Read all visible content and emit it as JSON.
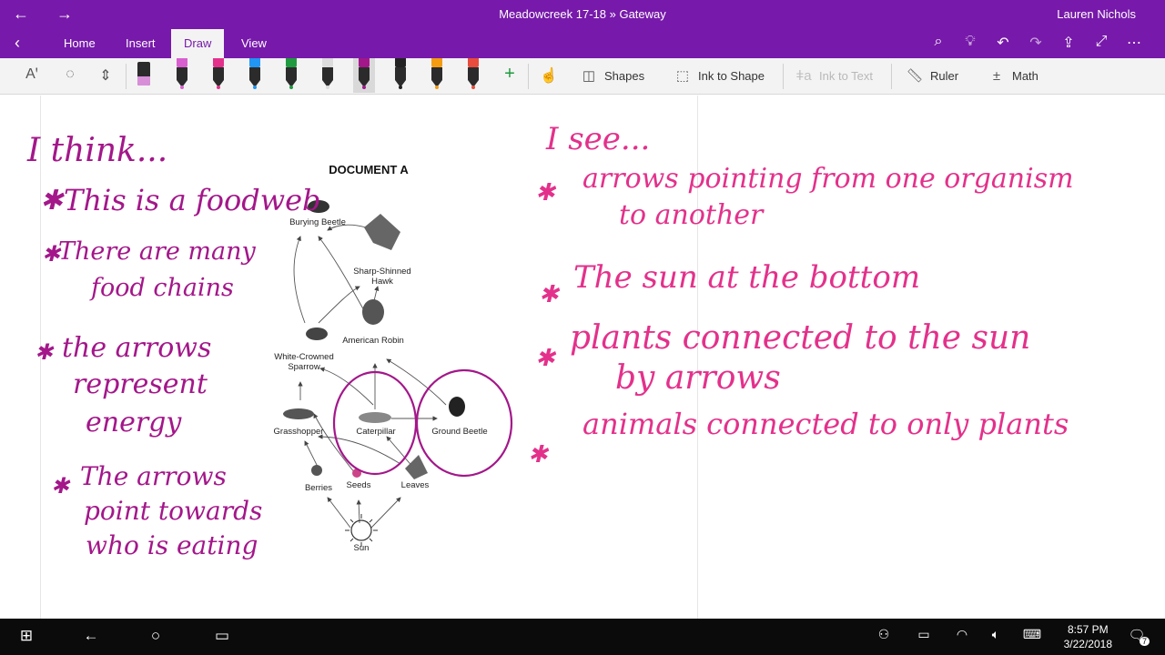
{
  "window": {
    "title": "Meadowcreek 17-18 » Gateway",
    "user": "Lauren Nichols"
  },
  "ribbon": {
    "tabs": [
      {
        "label": "Home"
      },
      {
        "label": "Insert"
      },
      {
        "label": "Draw",
        "active": true
      },
      {
        "label": "View"
      }
    ]
  },
  "toolbar": {
    "pen_colors": [
      "#d85fcf",
      "#e3318b",
      "#2196f3",
      "#1f9a3f",
      "#dcdcdc",
      "#a3178a",
      "#222222",
      "#f39c12",
      "#e74c3c"
    ],
    "selected_pen_index": 5,
    "shapes_label": "Shapes",
    "ink_to_shape_label": "Ink to Shape",
    "ink_to_text_label": "Ink to Text",
    "ruler_label": "Ruler",
    "math_label": "Math"
  },
  "document": {
    "title": "DOCUMENT A",
    "organisms": {
      "burying_beetle": "Burying Beetle",
      "hawk": "Sharp-Shinned Hawk",
      "robin": "American Robin",
      "sparrow": "White-Crowned Sparrow",
      "grasshopper": "Grasshopper",
      "caterpillar": "Caterpillar",
      "ground_beetle": "Ground Beetle",
      "berries": "Berries",
      "seeds": "Seeds",
      "leaves": "Leaves",
      "sun": "Sun"
    }
  },
  "notes": {
    "think_heading": "I think...",
    "think_1": "This is a foodweb",
    "think_2a": "There are many",
    "think_2b": "food chains",
    "think_3a": "the arrows",
    "think_3b": "represent",
    "think_3c": "energy",
    "think_4a": "The arrows",
    "think_4b": "point towards",
    "think_4c": "who is eating",
    "see_heading": "I see...",
    "see_1a": "arrows pointing from one organism",
    "see_1b": "to another",
    "see_2": "The sun at the bottom",
    "see_3a": "plants connected to the sun",
    "see_3b": "by arrows",
    "see_4": "animals connected to only plants"
  },
  "taskbar": {
    "time": "8:57 PM",
    "date": "3/22/2018",
    "notification_count": "7"
  }
}
